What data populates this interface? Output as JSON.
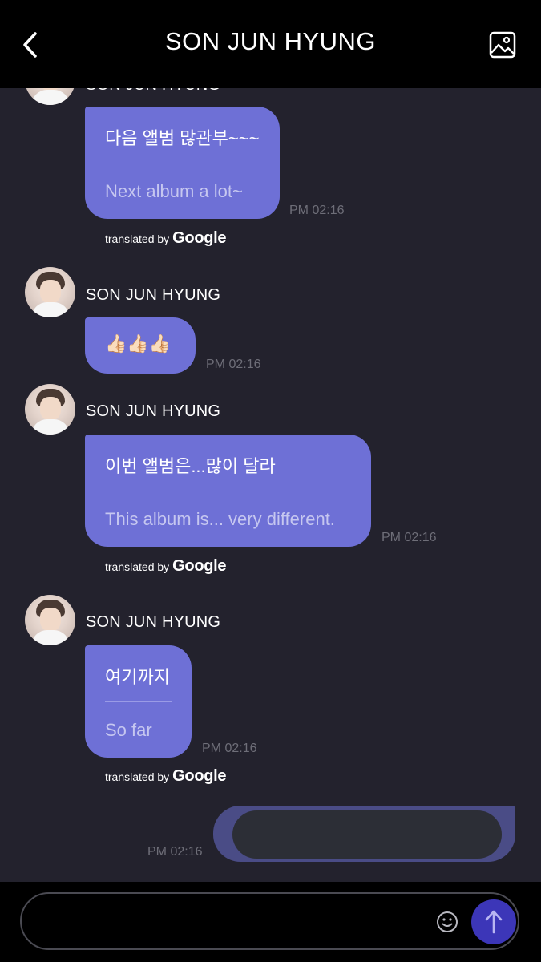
{
  "header": {
    "title": "SON JUN HYUNG"
  },
  "messages": [
    {
      "sender": "SON JUN HYUNG",
      "original": "다음 앨범 많관부~~~",
      "translation": "Next album a lot~",
      "time": "PM 02:16",
      "credit": "translated by"
    },
    {
      "sender": "SON JUN HYUNG",
      "original": "👍🏻👍🏻👍🏻",
      "time": "PM 02:16"
    },
    {
      "sender": "SON JUN HYUNG",
      "original": "이번 앨범은...많이 달라",
      "translation": "This album is... very different.",
      "time": "PM 02:16",
      "credit": "translated by"
    },
    {
      "sender": "SON JUN HYUNG",
      "original": "여기까지",
      "translation": "So far",
      "time": "PM 02:16",
      "credit": "translated by"
    }
  ],
  "my_message": {
    "time": "PM 02:16"
  },
  "google_logo": "Google",
  "colors": {
    "background": "#23222d",
    "bubble": "#6e70d6",
    "my_bubble": "#4a4c86",
    "send_button": "#3c36b8",
    "header": "#000000"
  },
  "icons": {
    "back": "chevron-left-icon",
    "gallery": "image-icon",
    "emoji": "smiley-icon",
    "send": "arrow-up-icon"
  }
}
